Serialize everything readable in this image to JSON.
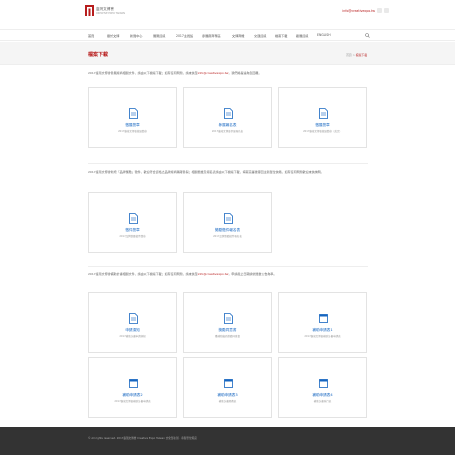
{
  "header": {
    "logo_title": "臺灣文博會",
    "logo_subtitle": "CREATIVE EXPO TAIWAN",
    "contact": "info@creativexpo.tw"
  },
  "nav": {
    "items": [
      "首頁",
      "關於文博",
      "新聞中心",
      "展覽資訊",
      "2017主題館",
      "參展廠商專區",
      "文博商機",
      "交通資訊",
      "檔案下載",
      "觀展資訊",
      "ENGLISH"
    ]
  },
  "page": {
    "title": "檔案下載",
    "breadcrumb_home": "首頁",
    "breadcrumb_sep": ">",
    "breadcrumb_current": "檔案下載"
  },
  "sections": [
    {
      "intro": "2017臺灣文博會參展廠商相關文件，請由以下檔案下載；如有任何問題，請來信至",
      "intro_email": "info@creativexpo.tw",
      "intro_tail": "，我們將盡速為您回覆。",
      "cards": [
        {
          "title": "徵展簡章",
          "subtitle": "2017臺灣文博會徵展簡章"
        },
        {
          "title": "參展報名表",
          "subtitle": "2017臺灣文博會參展報名表"
        },
        {
          "title": "徵展簡章",
          "subtitle": "2017臺灣文博會徵展簡章（英文）"
        }
      ]
    },
    {
      "intro": "2017臺灣文博會新增「品牌獎勵」徵件，歡迎符合資格之品牌廠商踴躍參與；相關簡章及報名表請由以下檔案下載，填寫完畢後寄回主辦單位信箱，如有任何問題歡迎來信詢問。",
      "cards": [
        {
          "title": "徵件簡章",
          "subtitle": "2017品牌獎勵徵件簡章"
        },
        {
          "title": "獎勵徵件報名表",
          "subtitle": "2017品牌獎勵徵件報名表"
        }
      ]
    },
    {
      "intro": "2017臺灣文博會補助計畫相關文件，請由以下檔案下載；如有任何問題，請來信至",
      "intro_email": "info@creativexpo.tw",
      "intro_tail": "，申請截止日期請依簡章公告為準。",
      "cards": [
        {
          "title": "申請須知",
          "subtitle": "2017補助計畫申請須知"
        },
        {
          "title": "獎勵同意書",
          "subtitle": "獲補助廠商獎勵同意書"
        },
        {
          "title": "補助申請表1",
          "subtitle": "2017臺灣文博會補助計畫申請表"
        },
        {
          "title": "補助申請表2",
          "subtitle": "2017臺灣文博會補助計畫申請表"
        },
        {
          "title": "補助申請表3",
          "subtitle": "補助計畫經費表"
        },
        {
          "title": "補助申請表4",
          "subtitle": "補助計畫執行表"
        }
      ]
    }
  ],
  "footer": {
    "text": "© All rights reserved. 2017臺灣文博會 Creative Expo Taiwan 文化部主辦 · 承辦單位資訊"
  },
  "colors": {
    "brand": "#b71c1c",
    "link": "#1565c0",
    "footer_bg": "#333333"
  }
}
